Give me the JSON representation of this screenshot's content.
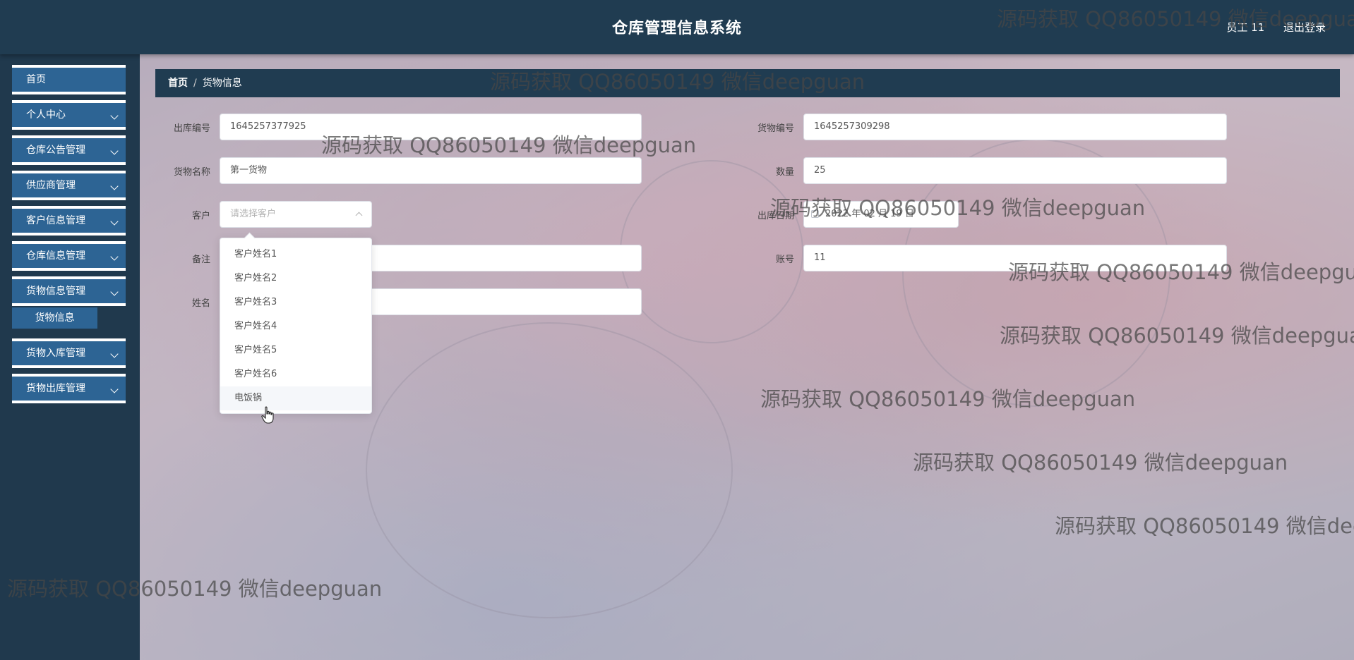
{
  "header": {
    "title": "仓库管理信息系统",
    "user_label": "员工 11",
    "logout_label": "退出登录"
  },
  "sidebar": {
    "items": [
      {
        "label": "首页",
        "has_arrow": false
      },
      {
        "label": "个人中心",
        "has_arrow": true
      },
      {
        "label": "仓库公告管理",
        "has_arrow": true
      },
      {
        "label": "供应商管理",
        "has_arrow": true
      },
      {
        "label": "客户信息管理",
        "has_arrow": true
      },
      {
        "label": "仓库信息管理",
        "has_arrow": true
      },
      {
        "label": "货物信息管理",
        "has_arrow": true
      },
      {
        "label": "货物入库管理",
        "has_arrow": true
      },
      {
        "label": "货物出库管理",
        "has_arrow": true
      }
    ],
    "sub_item": "货物信息"
  },
  "breadcrumb": {
    "home": "首页",
    "separator": "/",
    "current": "货物信息"
  },
  "form": {
    "outbound_no": {
      "label": "出库编号",
      "value": "1645257377925"
    },
    "goods_no": {
      "label": "货物编号",
      "value": "1645257309298"
    },
    "goods_name": {
      "label": "货物名称",
      "value": "第一货物"
    },
    "quantity": {
      "label": "数量",
      "value": "25"
    },
    "customer": {
      "label": "客户",
      "placeholder": "请选择客户"
    },
    "outbound_date": {
      "label": "出库日期",
      "value": "2022 年 02 月 19 日"
    },
    "remark": {
      "label": "备注",
      "value": ""
    },
    "account": {
      "label": "账号",
      "value": "11"
    },
    "name": {
      "label": "姓名",
      "value": ""
    }
  },
  "dropdown": {
    "options": [
      "客户姓名1",
      "客户姓名2",
      "客户姓名3",
      "客户姓名4",
      "客户姓名5",
      "客户姓名6",
      "电饭锅"
    ],
    "hovered_index": 6
  },
  "watermark_text": "源码获取 QQ86050149 微信deepguan",
  "colors": {
    "header_bg": "#203c51",
    "menu_bg": "#2d6494",
    "sidebar_bg": "#20394d"
  }
}
